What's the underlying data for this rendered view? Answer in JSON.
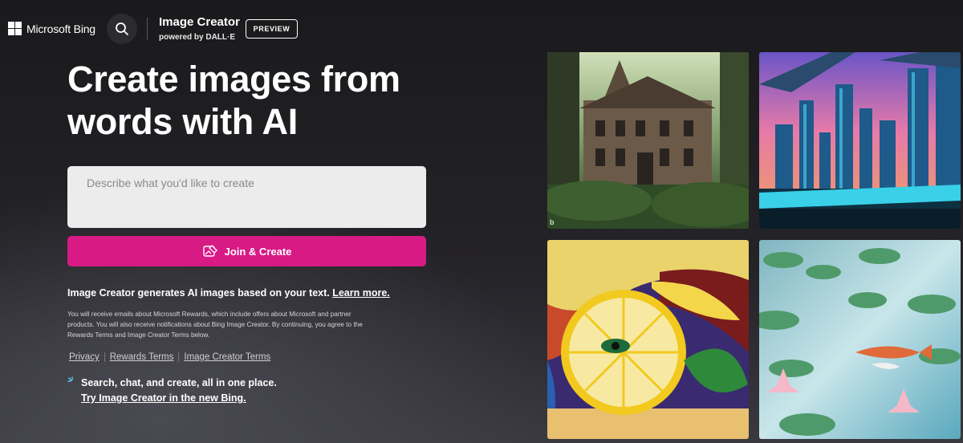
{
  "header": {
    "brand": "Microsoft Bing",
    "product_title": "Image Creator",
    "product_subtitle": "powered by DALL·E",
    "badge": "PREVIEW"
  },
  "hero": {
    "headline": "Create images from words with AI"
  },
  "prompt": {
    "placeholder": "Describe what you'd like to create",
    "value": ""
  },
  "join_button": {
    "label": "Join & Create"
  },
  "info": {
    "text": "Image Creator generates AI images based on your text. ",
    "learn_more": "Learn more."
  },
  "fineprint": "You will receive emails about Microsoft Rewards, which include offers about Microsoft and partner products. You will also receive notifications about Bing Image Creator. By continuing, you agree to the Rewards Terms and Image Creator Terms below.",
  "footer_links": [
    "Privacy",
    "Rewards Terms",
    "Image Creator Terms"
  ],
  "new_bing": {
    "text": "Search, chat, and create, all in one place.",
    "link": "Try Image Creator in the new Bing."
  },
  "gallery": {
    "tiles": [
      {
        "subject": "haunted-mansion-in-forest",
        "mark": "b"
      },
      {
        "subject": "futuristic-neon-city",
        "mark": ""
      },
      {
        "subject": "lemon-slices-still-life",
        "mark": ""
      },
      {
        "subject": "koi-pond-with-lily-pads",
        "mark": ""
      }
    ]
  },
  "colors": {
    "accent": "#d81a85",
    "background": "#1b1a1c",
    "prompt_bg": "#ececec"
  }
}
